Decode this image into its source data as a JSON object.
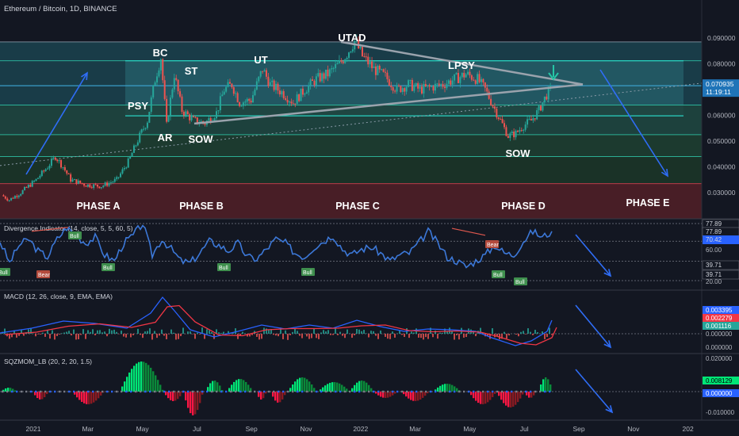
{
  "header": {
    "symbol_title": "Ethereum / Bitcoin, 1D, BINANCE",
    "currency": "BTC"
  },
  "x_axis": {
    "labels": [
      "2021",
      "Mar",
      "May",
      "Jul",
      "Sep",
      "Nov",
      "2022",
      "Mar",
      "May",
      "Jul",
      "Sep",
      "Nov",
      "202"
    ]
  },
  "chart_data": [
    {
      "type": "candlestick",
      "title": "Ethereum / Bitcoin, 1D, BINANCE",
      "unit": "BTC",
      "y_ticks": [
        0.09,
        0.08,
        0.07,
        0.06,
        0.05,
        0.04,
        0.03
      ],
      "ylim": [
        0.0213,
        0.0935
      ],
      "last_price": "0.070935",
      "countdown": "11:19:11",
      "price_series_approx": [
        [
          0.0,
          0.029
        ],
        [
          0.2,
          0.0272
        ],
        [
          0.5,
          0.03
        ],
        [
          0.9,
          0.035
        ],
        [
          1.2,
          0.04
        ],
        [
          1.4,
          0.044
        ],
        [
          1.6,
          0.04
        ],
        [
          1.8,
          0.035
        ],
        [
          2.2,
          0.033
        ],
        [
          2.6,
          0.0325
        ],
        [
          3.0,
          0.035
        ],
        [
          3.3,
          0.042
        ],
        [
          3.6,
          0.052
        ],
        [
          3.8,
          0.058
        ],
        [
          4.0,
          0.074
        ],
        [
          4.15,
          0.0825
        ],
        [
          4.3,
          0.056
        ],
        [
          4.5,
          0.076
        ],
        [
          4.7,
          0.062
        ],
        [
          5.0,
          0.058
        ],
        [
          5.3,
          0.057
        ],
        [
          5.6,
          0.061
        ],
        [
          5.8,
          0.07
        ],
        [
          6.0,
          0.072
        ],
        [
          6.2,
          0.065
        ],
        [
          6.5,
          0.066
        ],
        [
          6.8,
          0.078
        ],
        [
          7.0,
          0.072
        ],
        [
          7.3,
          0.069
        ],
        [
          7.6,
          0.065
        ],
        [
          7.9,
          0.07
        ],
        [
          8.2,
          0.074
        ],
        [
          8.5,
          0.076
        ],
        [
          8.8,
          0.08
        ],
        [
          9.0,
          0.084
        ],
        [
          9.2,
          0.089
        ],
        [
          9.4,
          0.083
        ],
        [
          9.7,
          0.078
        ],
        [
          10.0,
          0.075
        ],
        [
          10.3,
          0.07
        ],
        [
          10.6,
          0.072
        ],
        [
          10.9,
          0.07
        ],
        [
          11.2,
          0.071
        ],
        [
          11.5,
          0.072
        ],
        [
          11.8,
          0.074
        ],
        [
          12.1,
          0.076
        ],
        [
          12.4,
          0.074
        ],
        [
          12.6,
          0.07
        ],
        [
          12.8,
          0.064
        ],
        [
          13.0,
          0.058
        ],
        [
          13.2,
          0.052
        ],
        [
          13.4,
          0.053
        ],
        [
          13.6,
          0.056
        ],
        [
          13.8,
          0.058
        ],
        [
          14.0,
          0.062
        ],
        [
          14.2,
          0.068
        ],
        [
          14.35,
          0.0709
        ]
      ],
      "levels": [
        0.0885,
        0.0812,
        0.0715,
        0.064,
        0.0525,
        0.044,
        0.0335
      ],
      "phase_zones": [
        {
          "label": "PHASE A",
          "from": 0.0212,
          "to": 0.0335,
          "color": "#5c1f26"
        },
        {
          "label": "PHASE B",
          "from": 0.0335,
          "to": 0.044,
          "color": "#1e3b2c"
        },
        {
          "label": "PHASE C",
          "from": 0.044,
          "to": 0.0525,
          "color": "#1e4434"
        },
        {
          "label": "PHASE D",
          "from": 0.0525,
          "to": 0.064,
          "color": "#1d4a42"
        },
        {
          "label": "PHASE E",
          "from": 0.064,
          "to": 0.0812,
          "color": "#21505a"
        }
      ],
      "annotations": [
        "PSY",
        "BC",
        "AR",
        "ST",
        "SOW",
        "UT",
        "UTAD",
        "LPSY",
        "SOW"
      ],
      "phase_labels": [
        "PHASE A",
        "PHASE B",
        "PHASE C",
        "PHASE D",
        "PHASE E"
      ]
    },
    {
      "type": "line",
      "title": "Divergence Indicator (14, close, 5, 5, 60, 5)",
      "y_ticks": [
        77.89,
        60.0,
        39.71,
        20.0
      ],
      "ylim": [
        17,
        81
      ],
      "badges": [
        "77.89",
        "77.89",
        "70.42",
        "39.71",
        "39.71"
      ],
      "upper_band": 60,
      "lower_band": 40,
      "signals": [
        {
          "label": "Bull",
          "x": 0.05,
          "y": 42
        },
        {
          "label": "Bear",
          "x": 1.2,
          "y": 74
        },
        {
          "label": "Bull",
          "x": 0.75,
          "y": 39
        },
        {
          "label": "Bull",
          "x": 1.95,
          "y": 42
        },
        {
          "label": "Bull",
          "x": 4.05,
          "y": 42
        },
        {
          "label": "Bull",
          "x": 5.6,
          "y": 40
        },
        {
          "label": "Bear",
          "x": 9.05,
          "y": 71
        },
        {
          "label": "Bull",
          "x": 9.2,
          "y": 38
        },
        {
          "label": "Bull",
          "x": 9.55,
          "y": 35
        }
      ],
      "values_approx": [
        60,
        38,
        56,
        62,
        50,
        44,
        62,
        74,
        66,
        58,
        64,
        46,
        40,
        58,
        66,
        78,
        46,
        62,
        52,
        40,
        38,
        48,
        60,
        56,
        50,
        58,
        44,
        42,
        52,
        62,
        58,
        48,
        44,
        54,
        60,
        66,
        52,
        46,
        52,
        54,
        48,
        40,
        46,
        48,
        58,
        70,
        58,
        44,
        40,
        34,
        40,
        46,
        56,
        48,
        46,
        60,
        70,
        64,
        70
      ]
    },
    {
      "type": "line",
      "title": "MACD (12, 26, close, 9, EMA, EMA)",
      "y_ticks": [
        0.0,
        0.0
      ],
      "badges": [
        "0.003395",
        "0.002279",
        "0.001116"
      ],
      "series": [
        {
          "name": "MACD",
          "color": "#2962ff"
        },
        {
          "name": "Signal",
          "color": "#f23645"
        }
      ]
    },
    {
      "type": "bar",
      "title": "SQZMOM_LB (20, 2, 20, 1.5)",
      "y_ticks": [
        0.02,
        0.0,
        -0.01
      ],
      "badges": [
        "0.008129",
        "0.000000"
      ]
    }
  ]
}
